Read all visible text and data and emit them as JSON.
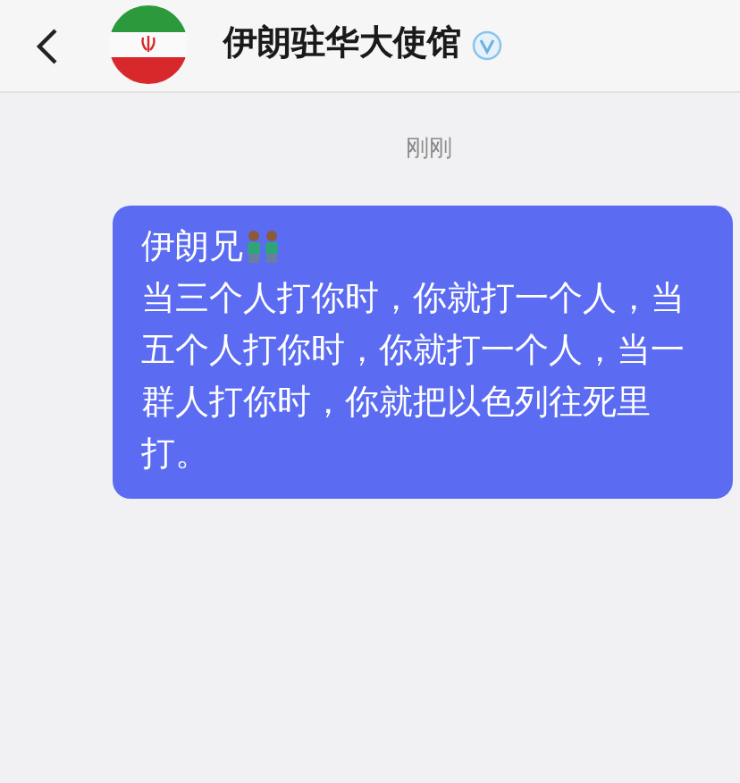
{
  "header": {
    "title": "伊朗驻华大使馆",
    "verified": true
  },
  "timestamp": "刚刚",
  "messages": [
    {
      "sender_line": "伊朗兄",
      "text": "当三个人打你时，你就打一个人，当五个人打你时，你就打一个人，当一群人打你时，你就把以色列往死里打。"
    }
  ]
}
